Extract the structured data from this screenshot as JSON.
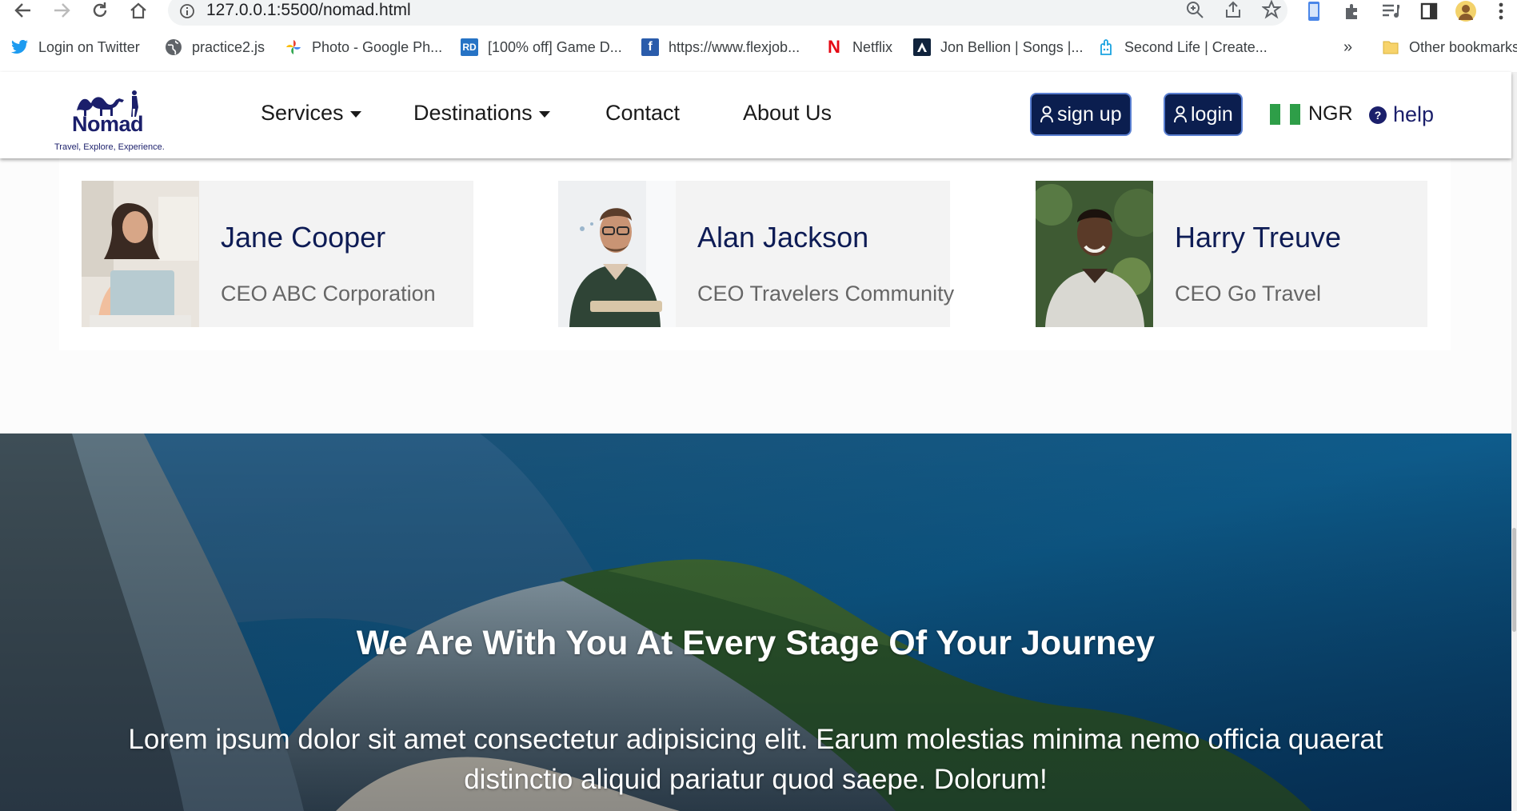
{
  "browser": {
    "url": "127.0.0.1:5500/nomad.html",
    "bookmarks": [
      {
        "label": "Login on Twitter",
        "icon": "twitter-icon"
      },
      {
        "label": "practice2.js",
        "icon": "globe-icon"
      },
      {
        "label": "Photo - Google Ph...",
        "icon": "google-photos-icon"
      },
      {
        "label": "[100% off] Game D...",
        "icon": "rd-icon"
      },
      {
        "label": "https://www.flexjob...",
        "icon": "flexjobs-icon"
      },
      {
        "label": "Netflix",
        "icon": "netflix-icon"
      },
      {
        "label": "Jon Bellion | Songs |...",
        "icon": "jon-bellion-icon"
      },
      {
        "label": "Second Life | Create...",
        "icon": "second-life-icon"
      }
    ],
    "overflow_label": "»",
    "other_bookmarks": "Other bookmarks",
    "rd_badge": "RD",
    "flexjobs_badge": "f",
    "netflix_badge": "N"
  },
  "header": {
    "logo_brand": "Nomad",
    "logo_tagline": "Travel, Explore, Experience.",
    "menu": {
      "services": "Services",
      "destinations": "Destinations",
      "contact": "Contact",
      "about": "About Us"
    },
    "signup_label": "sign up",
    "login_label": "login",
    "country": "NGR",
    "help_label": "help",
    "help_glyph": "?"
  },
  "team": [
    {
      "name": "Jane Cooper",
      "role": "CEO ABC Corporation"
    },
    {
      "name": "Alan Jackson",
      "role": "CEO Travelers Community"
    },
    {
      "name": "Harry Treuve",
      "role": "CEO Go Travel"
    }
  ],
  "hero": {
    "title": "We Are With You At Every Stage Of Your Journey",
    "text": "Lorem ipsum dolor sit amet consectetur adipisicing elit. Earum molestias minima nemo officia quaerat distinctio aliquid pariatur quod saepe. Dolorum!"
  },
  "colors": {
    "brand_navy": "#0b1e4f",
    "logo_navy": "#1b1f6b",
    "card_bg": "#f3f3f3",
    "flag_green": "#2e9e48"
  }
}
